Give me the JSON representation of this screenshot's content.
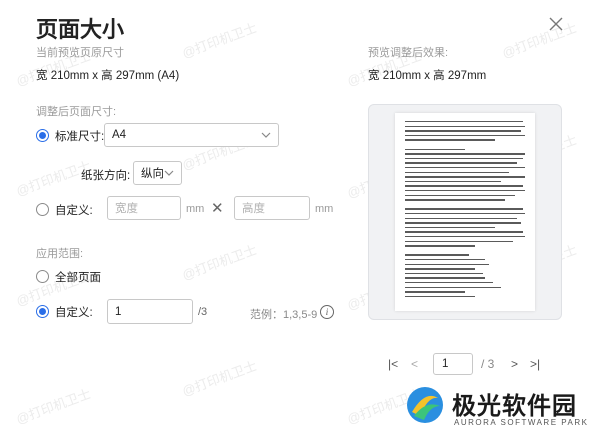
{
  "dialog": {
    "title": "页面大小",
    "current_size_label": "当前预览页原尺寸",
    "current_size_value": "宽 210mm x 高 297mm (A4)",
    "preview_label": "预览调整后效果:",
    "preview_size_value": "宽 210mm x 高 297mm",
    "adjusted_label": "调整后页面尺寸:",
    "standard_label": "标准尺寸:",
    "standard_value": "A4",
    "orientation_label": "纸张方向:",
    "orientation_value": "纵向",
    "custom_label": "自定义:",
    "width_placeholder": "宽度",
    "height_placeholder": "高度",
    "unit": "mm",
    "times": "✕",
    "range_label": "应用范围:",
    "all_pages_label": "全部页面",
    "custom_range_label": "自定义:",
    "custom_range_value": "1",
    "total_pages": "/3",
    "example_label": "范例：1,3,5-9",
    "info": "i"
  },
  "pager": {
    "first": "|<",
    "prev": "<",
    "current": "1",
    "total": "/ 3",
    "next": ">",
    "last": ">|"
  },
  "watermark": "@打印机卫士",
  "logo": {
    "name": "极光软件园",
    "subtitle": "AURORA SOFTWARE PARK"
  },
  "colors": {
    "accent": "#2a6ee8"
  },
  "state": {
    "standard_selected": true,
    "custom_size_selected": false,
    "all_pages_selected": false,
    "custom_range_selected": true
  }
}
